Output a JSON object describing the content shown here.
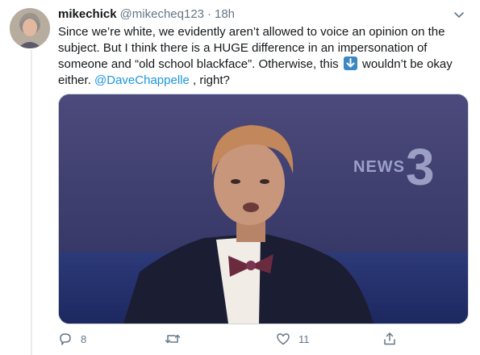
{
  "tweet": {
    "display_name": "mikechick",
    "handle": "@mikecheq123",
    "separator": "·",
    "time": "18h",
    "text_part1": "Since we’re white, we evidently aren’t allowed to voice an opinion on the subject. But I think there is a HUGE difference in an impersonation of someone and “old school blackface”. Otherwise, this ",
    "text_part2": " wouldn’t be okay either. ",
    "mention": "@DaveChappelle",
    "text_part3": " , right?",
    "emoji": "down-arrow-emoji",
    "media_logo": "NEWS 3",
    "media_logo_word": "NEWS",
    "media_logo_number": "3"
  },
  "actions": {
    "reply_count": "8",
    "retweet_count": "",
    "like_count": "11"
  },
  "colors": {
    "text": "#14171a",
    "muted": "#657786",
    "link": "#1b95e0",
    "emoji_blue": "#3b88c3"
  }
}
